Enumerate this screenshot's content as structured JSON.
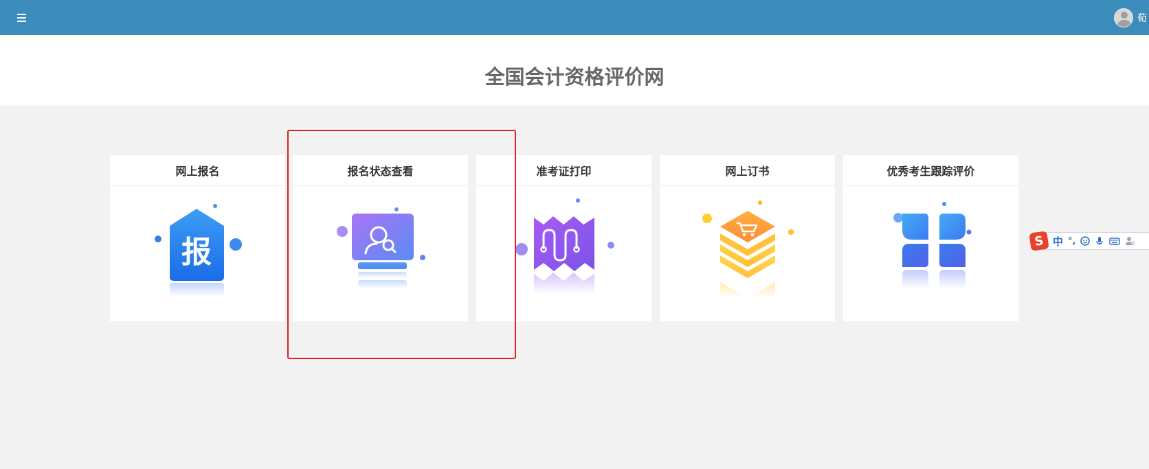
{
  "header": {
    "menu_icon": "hamburger-menu-icon",
    "user_name": "荀",
    "avatar_icon": "user-avatar-icon",
    "bg_color": "#3d8dbc"
  },
  "page": {
    "title": "全国会计资格评价网"
  },
  "cards": [
    {
      "label": "网上报名",
      "icon": "register-house-icon",
      "icon_text": "报"
    },
    {
      "label": "报名状态查看",
      "icon": "status-search-monitor-icon"
    },
    {
      "label": "准考证打印",
      "icon": "admission-ticket-wave-icon"
    },
    {
      "label": "网上订书",
      "icon": "cart-stack-icon"
    },
    {
      "label": "优秀考生跟踪评价",
      "icon": "four-petal-icon"
    }
  ],
  "ime_toolbar": {
    "logo": "S",
    "mode": "中",
    "punct": "°,",
    "icons": [
      "emoji-icon",
      "microphone-icon",
      "keyboard-icon",
      "user-settings-icon"
    ]
  },
  "highlight_color": "#e02020"
}
